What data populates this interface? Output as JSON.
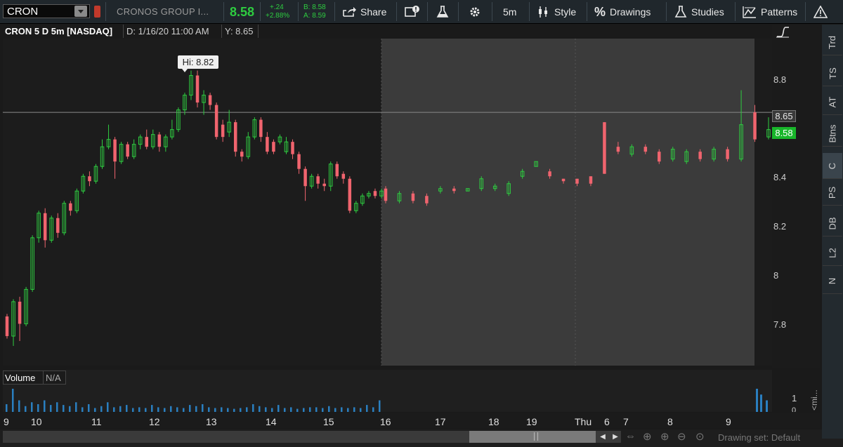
{
  "toolbar": {
    "symbol": "CRON",
    "company": "CRONOS GROUP I...",
    "last": "8.58",
    "change": "+.24",
    "change_pct": "+2.88%",
    "bid": "B: 8.58",
    "ask": "A: 8.59",
    "share": "Share",
    "timeframe": "5m",
    "style": "Style",
    "drawings": "Drawings",
    "studies": "Studies",
    "patterns": "Patterns"
  },
  "header": {
    "title": "CRON 5 D 5m [NASDAQ]",
    "date": "D: 1/16/20 11:00 AM",
    "y": "Y: 8.65"
  },
  "price_axis": {
    "labels": [
      "8.8",
      "8.6",
      "8.4",
      "8.2",
      "8",
      "7.8"
    ],
    "current_line_label": "8.65",
    "last_label": "8.58",
    "hi_label": "Hi: 8.82"
  },
  "volume_panel": {
    "label": "Volume",
    "value": "N/A",
    "axis_labels": [
      "1",
      "0"
    ]
  },
  "time_axis": {
    "labels": [
      "9",
      "10",
      "11",
      "12",
      "13",
      "14",
      "15",
      "16",
      "17",
      "18",
      "19",
      "Thu",
      "6",
      "7",
      "8",
      "9"
    ]
  },
  "right_tabs": [
    "Trd",
    "TS",
    "AT",
    "Btns",
    "C",
    "PS",
    "DB",
    "L2",
    "N"
  ],
  "right_tabs_active": "C",
  "bottom": {
    "drawing_set": "Drawing set: Default",
    "collapse_label": "<mi..."
  },
  "colors": {
    "up": "#2ecc40",
    "down": "#f0646e",
    "volume": "#2a7fc0",
    "background": "#262626",
    "extended_hours": "#3b3b3b"
  },
  "chart_data": {
    "type": "candlestick",
    "ylim": [
      7.62,
      8.95
    ],
    "current_price_line": 8.65,
    "candles": [
      [
        "d",
        7.82,
        7.74,
        7.83,
        7.73
      ],
      [
        "u",
        7.74,
        7.88,
        7.89,
        7.7
      ],
      [
        "d",
        7.88,
        7.79,
        7.9,
        7.72
      ],
      [
        "u",
        7.79,
        7.93,
        7.94,
        7.78
      ],
      [
        "u",
        7.93,
        8.14,
        8.15,
        7.92
      ],
      [
        "u",
        8.14,
        8.24,
        8.25,
        8.12
      ],
      [
        "d",
        8.24,
        8.13,
        8.26,
        8.1
      ],
      [
        "u",
        8.13,
        8.22,
        8.23,
        8.12
      ],
      [
        "d",
        8.22,
        8.16,
        8.24,
        8.14
      ],
      [
        "u",
        8.16,
        8.28,
        8.29,
        8.15
      ],
      [
        "d",
        8.28,
        8.25,
        8.29,
        8.23
      ],
      [
        "u",
        8.25,
        8.33,
        8.34,
        8.24
      ],
      [
        "u",
        8.33,
        8.39,
        8.4,
        8.32
      ],
      [
        "d",
        8.39,
        8.37,
        8.41,
        8.35
      ],
      [
        "u",
        8.37,
        8.43,
        8.44,
        8.36
      ],
      [
        "u",
        8.43,
        8.51,
        8.54,
        8.42
      ],
      [
        "u",
        8.51,
        8.54,
        8.6,
        8.5
      ],
      [
        "d",
        8.54,
        8.45,
        8.55,
        8.38
      ],
      [
        "u",
        8.45,
        8.52,
        8.53,
        8.44
      ],
      [
        "d",
        8.52,
        8.47,
        8.53,
        8.46
      ],
      [
        "u",
        8.47,
        8.52,
        8.54,
        8.46
      ],
      [
        "u",
        8.52,
        8.55,
        8.56,
        8.5
      ],
      [
        "d",
        8.55,
        8.51,
        8.58,
        8.5
      ],
      [
        "u",
        8.51,
        8.56,
        8.58,
        8.5
      ],
      [
        "d",
        8.56,
        8.51,
        8.57,
        8.49
      ],
      [
        "u",
        8.51,
        8.55,
        8.56,
        8.49
      ],
      [
        "u",
        8.55,
        8.58,
        8.62,
        8.54
      ],
      [
        "u",
        8.58,
        8.66,
        8.67,
        8.57
      ],
      [
        "u",
        8.66,
        8.72,
        8.73,
        8.64
      ],
      [
        "u",
        8.72,
        8.8,
        8.82,
        8.7
      ],
      [
        "d",
        8.8,
        8.69,
        8.82,
        8.67
      ],
      [
        "u",
        8.69,
        8.72,
        8.74,
        8.64
      ],
      [
        "d",
        8.72,
        8.68,
        8.73,
        8.66
      ],
      [
        "d",
        8.68,
        8.55,
        8.69,
        8.54
      ],
      [
        "d",
        8.55,
        8.6,
        8.62,
        8.53
      ],
      [
        "u",
        8.57,
        8.61,
        8.66,
        8.55
      ],
      [
        "d",
        8.61,
        8.49,
        8.62,
        8.47
      ],
      [
        "d",
        8.49,
        8.47,
        8.5,
        8.45
      ],
      [
        "u",
        8.47,
        8.55,
        8.57,
        8.46
      ],
      [
        "u",
        8.55,
        8.62,
        8.63,
        8.54
      ],
      [
        "d",
        8.62,
        8.55,
        8.63,
        8.53
      ],
      [
        "d",
        8.55,
        8.49,
        8.57,
        8.48
      ],
      [
        "d",
        8.49,
        8.53,
        8.54,
        8.48
      ],
      [
        "u",
        8.53,
        8.55,
        8.56,
        8.52
      ],
      [
        "u",
        8.49,
        8.53,
        8.55,
        8.48
      ],
      [
        "d",
        8.53,
        8.48,
        8.54,
        8.46
      ],
      [
        "d",
        8.48,
        8.42,
        8.49,
        8.4
      ],
      [
        "d",
        8.42,
        8.35,
        8.43,
        8.29
      ],
      [
        "u",
        8.35,
        8.39,
        8.4,
        8.34
      ],
      [
        "d",
        8.39,
        8.36,
        8.4,
        8.34
      ],
      [
        "d",
        8.36,
        8.35,
        8.38,
        8.33
      ],
      [
        "u",
        8.35,
        8.44,
        8.45,
        8.33
      ],
      [
        "d",
        8.44,
        8.39,
        8.45,
        8.38
      ],
      [
        "d",
        8.4,
        8.38,
        8.41,
        8.36
      ],
      [
        "d",
        8.38,
        8.25,
        8.39,
        8.24
      ],
      [
        "u",
        8.25,
        8.28,
        8.29,
        8.24
      ],
      [
        "u",
        8.28,
        8.31,
        8.32,
        8.27
      ],
      [
        "u",
        8.31,
        8.32,
        8.33,
        8.3
      ],
      [
        "d",
        8.33,
        8.31,
        8.34,
        8.3
      ],
      [
        "u",
        8.31,
        8.33,
        8.34,
        8.3
      ]
    ],
    "extended_candles": [
      [
        "d",
        8.34,
        8.29,
        8.35,
        8.28
      ],
      [
        "u",
        8.29,
        8.32,
        8.33,
        8.28
      ],
      [
        "d",
        8.32,
        8.29,
        8.33,
        8.28
      ],
      [
        "d",
        8.31,
        8.28,
        8.32,
        8.27
      ],
      [
        "u",
        8.33,
        8.34,
        8.35,
        8.32
      ],
      [
        "d",
        8.34,
        8.33,
        8.35,
        8.32
      ],
      [
        "u",
        8.33,
        8.34,
        8.34,
        8.33
      ],
      [
        "u",
        8.34,
        8.38,
        8.39,
        8.33
      ],
      [
        "u",
        8.34,
        8.35,
        8.36,
        8.33
      ],
      [
        "u",
        8.32,
        8.36,
        8.37,
        8.31
      ],
      [
        "u",
        8.39,
        8.41,
        8.42,
        8.38
      ],
      [
        "u",
        8.43,
        8.45,
        8.45,
        8.43
      ],
      [
        "d",
        8.41,
        8.39,
        8.42,
        8.38
      ],
      [
        "d",
        8.38,
        8.37,
        8.38,
        8.36
      ],
      [
        "d",
        8.38,
        8.36,
        8.38,
        8.35
      ],
      [
        "d",
        8.39,
        8.36,
        8.39,
        8.35
      ],
      [
        "d",
        8.61,
        8.4,
        8.61,
        8.4
      ],
      [
        "d",
        8.51,
        8.49,
        8.53,
        8.48
      ],
      [
        "u",
        8.48,
        8.51,
        8.52,
        8.47
      ],
      [
        "d",
        8.51,
        8.49,
        8.52,
        8.48
      ],
      [
        "d",
        8.49,
        8.45,
        8.5,
        8.44
      ],
      [
        "u",
        8.46,
        8.5,
        8.51,
        8.45
      ],
      [
        "u",
        8.45,
        8.49,
        8.5,
        8.44
      ],
      [
        "d",
        8.49,
        8.46,
        8.5,
        8.45
      ],
      [
        "u",
        8.46,
        8.5,
        8.51,
        8.45
      ],
      [
        "d",
        8.5,
        8.46,
        8.51,
        8.45
      ],
      [
        "u",
        8.46,
        8.6,
        8.74,
        8.45
      ],
      [
        "d",
        8.65,
        8.54,
        8.68,
        8.53
      ],
      [
        "u",
        8.55,
        8.58,
        8.63,
        8.54
      ]
    ],
    "volume": [
      0.2,
      0.6,
      0.3,
      0.15,
      0.25,
      0.2,
      0.3,
      0.18,
      0.25,
      0.18,
      0.15,
      0.25,
      0.12,
      0.2,
      0.1,
      0.15,
      0.25,
      0.12,
      0.15,
      0.18,
      0.1,
      0.12,
      0.1,
      0.18,
      0.12,
      0.1,
      0.15,
      0.12,
      0.1,
      0.18,
      0.15,
      0.2,
      0.12,
      0.1,
      0.12,
      0.1,
      0.08,
      0.1,
      0.12,
      0.2,
      0.15,
      0.12,
      0.1,
      0.18,
      0.1,
      0.12,
      0.08,
      0.1,
      0.12,
      0.12,
      0.1,
      0.15,
      0.1,
      0.12,
      0.1,
      0.12,
      0.1,
      0.18,
      0.12,
      0.3
    ]
  }
}
